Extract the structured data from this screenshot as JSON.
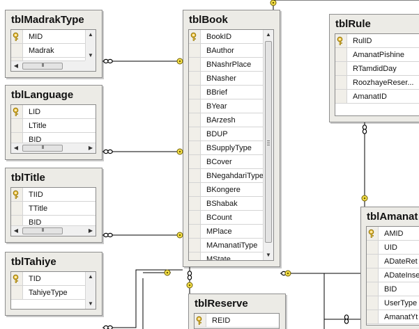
{
  "tables": {
    "tblMadrakType": {
      "title": "tblMadrakType",
      "columns": [
        {
          "name": "MID",
          "key": true
        },
        {
          "name": "Madrak",
          "key": false
        },
        {
          "name": "BID",
          "key": false
        }
      ]
    },
    "tblLanguage": {
      "title": "tblLanguage",
      "columns": [
        {
          "name": "LID",
          "key": true
        },
        {
          "name": "LTitle",
          "key": false
        },
        {
          "name": "BID",
          "key": false
        }
      ]
    },
    "tblTitle": {
      "title": "tblTitle",
      "columns": [
        {
          "name": "TIID",
          "key": true
        },
        {
          "name": "TTitle",
          "key": false
        },
        {
          "name": "BID",
          "key": false
        }
      ]
    },
    "tblTahiye": {
      "title": "tblTahiye",
      "columns": [
        {
          "name": "TID",
          "key": true
        },
        {
          "name": "TahiyeType",
          "key": false
        }
      ]
    },
    "tblBook": {
      "title": "tblBook",
      "columns": [
        {
          "name": "BookID",
          "key": true
        },
        {
          "name": "BAuthor",
          "key": false
        },
        {
          "name": "BNashrPlace",
          "key": false
        },
        {
          "name": "BNasher",
          "key": false
        },
        {
          "name": "BBrief",
          "key": false
        },
        {
          "name": "BYear",
          "key": false
        },
        {
          "name": "BArzesh",
          "key": false
        },
        {
          "name": "BDUP",
          "key": false
        },
        {
          "name": "BSupplyType",
          "key": false
        },
        {
          "name": "BCover",
          "key": false
        },
        {
          "name": "BNegahdariType",
          "key": false
        },
        {
          "name": "BKongere",
          "key": false
        },
        {
          "name": "BShabak",
          "key": false
        },
        {
          "name": "BCount",
          "key": false
        },
        {
          "name": "MPlace",
          "key": false
        },
        {
          "name": "MAmanatiType",
          "key": false
        },
        {
          "name": "MState",
          "key": false
        }
      ]
    },
    "tblRule": {
      "title": "tblRule",
      "columns": [
        {
          "name": "RulID",
          "key": true
        },
        {
          "name": "AmanatPishine",
          "key": false
        },
        {
          "name": "RTamdidDay",
          "key": false
        },
        {
          "name": "RoozhayeReser...",
          "key": false
        },
        {
          "name": "AmanatID",
          "key": false
        }
      ]
    },
    "tblAmanat": {
      "title": "tblAmanat",
      "columns": [
        {
          "name": "AMID",
          "key": true
        },
        {
          "name": "UID",
          "key": false
        },
        {
          "name": "ADateRet",
          "key": false
        },
        {
          "name": "ADateInse",
          "key": false
        },
        {
          "name": "BID",
          "key": false
        },
        {
          "name": "UserType",
          "key": false
        },
        {
          "name": "AmanatYt",
          "key": false
        }
      ]
    },
    "tblReserve": {
      "title": "tblReserve",
      "columns": [
        {
          "name": "REID",
          "key": true
        }
      ]
    }
  },
  "relationships": [
    {
      "from": "tblMadrakType",
      "to": "tblBook"
    },
    {
      "from": "tblLanguage",
      "to": "tblBook"
    },
    {
      "from": "tblTitle",
      "to": "tblBook"
    },
    {
      "from": "tblTahiye",
      "to": "tblBook"
    },
    {
      "from": "tblBook",
      "to": "tblAmanat"
    },
    {
      "from": "tblBook",
      "to": "tblReserve"
    },
    {
      "from": "tblRule",
      "to": "tblAmanat"
    },
    {
      "from": "tblBook",
      "to": "external-top"
    }
  ],
  "scroll_thumb_glyph": "III",
  "colors": {
    "line": "#000000",
    "key": "#f2c94c",
    "keyStroke": "#8a6d00"
  }
}
